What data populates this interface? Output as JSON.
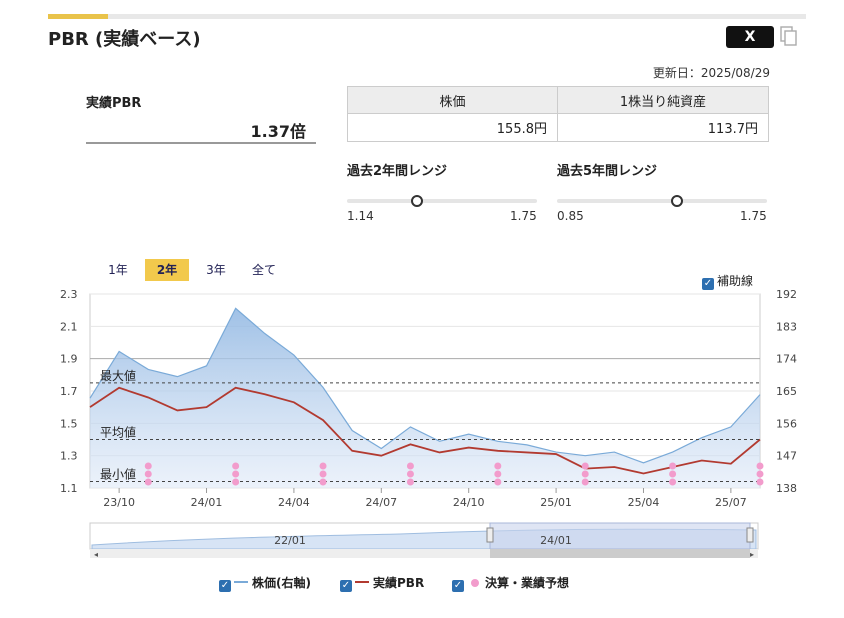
{
  "header": {
    "title": "PBR (実績ベース)",
    "x_label": "X",
    "updated": "更新日：2025/08/29"
  },
  "pbr": {
    "label": "実績PBR",
    "value": "1.37倍"
  },
  "price_table": {
    "headers": [
      "株価",
      "1株当り純資産"
    ],
    "values": [
      "155.8円",
      "113.7円"
    ]
  },
  "ranges": [
    {
      "title": "過去2年間レンジ",
      "min": "1.14",
      "max": "1.75",
      "current": 1.37
    },
    {
      "title": "過去5年間レンジ",
      "min": "0.85",
      "max": "1.75",
      "current": 1.37
    }
  ],
  "period_tabs": [
    "1年",
    "2年",
    "3年",
    "全て"
  ],
  "active_tab": "2年",
  "aux_line": "補助線",
  "legend": {
    "price": "株価(右軸)",
    "pbr": "実績PBR",
    "earnings": "決算・業績予想"
  },
  "colors": {
    "price_line": "#7aaad8",
    "pbr_line": "#b23a30",
    "earnings_dot": "#f29ccc",
    "accent": "#f2c94c"
  },
  "chart_data": {
    "type": "line",
    "x": [
      "23/09",
      "23/10",
      "23/11",
      "23/12",
      "24/01",
      "24/02",
      "24/03",
      "24/04",
      "24/05",
      "24/06",
      "24/07",
      "24/08",
      "24/09",
      "24/10",
      "24/11",
      "24/12",
      "25/01",
      "25/02",
      "25/03",
      "25/04",
      "25/05",
      "25/06",
      "25/07",
      "25/08"
    ],
    "xticks": [
      "23/10",
      "24/01",
      "24/04",
      "24/07",
      "24/10",
      "25/01",
      "25/04",
      "25/07"
    ],
    "series": [
      {
        "name": "実績PBR",
        "axis": "left",
        "values": [
          1.6,
          1.72,
          1.66,
          1.58,
          1.6,
          1.72,
          1.68,
          1.63,
          1.52,
          1.33,
          1.3,
          1.37,
          1.32,
          1.35,
          1.33,
          1.32,
          1.31,
          1.22,
          1.23,
          1.19,
          1.23,
          1.27,
          1.25,
          1.4
        ]
      },
      {
        "name": "株価(右軸)",
        "axis": "right",
        "values": [
          163,
          176,
          171,
          169,
          172,
          188,
          181,
          175,
          166,
          154,
          149,
          155,
          151,
          153,
          151,
          150,
          148,
          147,
          148,
          145,
          148,
          152,
          155,
          164
        ]
      }
    ],
    "yleft": {
      "ticks": [
        "2.3",
        "2.1",
        "1.9",
        "1.7",
        "1.5",
        "1.3",
        "1.1"
      ],
      "min": 1.1,
      "max": 2.3
    },
    "yright": {
      "ticks": [
        "192",
        "183",
        "174",
        "165",
        "156",
        "147",
        "138"
      ],
      "min": 138,
      "max": 192
    },
    "reference_lines": [
      {
        "label": "最大値",
        "value": 1.75
      },
      {
        "label": "平均値",
        "value": 1.4
      },
      {
        "label": "最小値",
        "value": 1.14
      }
    ],
    "earnings_months": [
      "23/11",
      "24/02",
      "24/05",
      "24/08",
      "24/11",
      "25/02",
      "25/05",
      "25/08"
    ],
    "navigator_ticks": [
      "22/01",
      "24/01"
    ],
    "aux_lines": true
  }
}
